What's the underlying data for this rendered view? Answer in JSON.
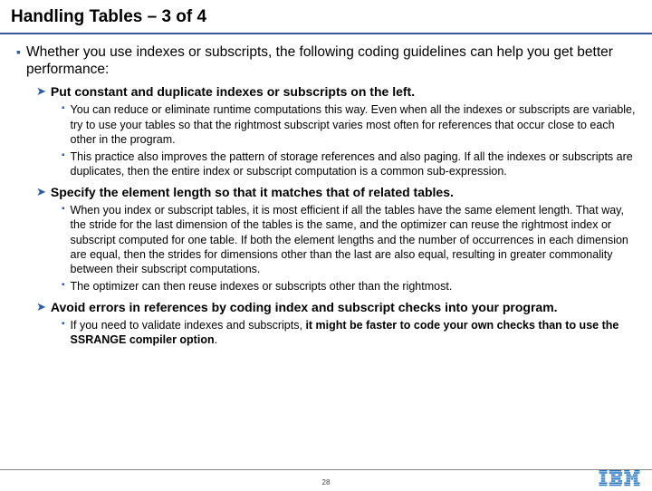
{
  "title": "Handling Tables – 3 of 4",
  "intro": "Whether you use indexes or subscripts, the following coding guidelines can help you get better performance:",
  "sections": [
    {
      "heading": "Put constant and duplicate indexes or subscripts on the left.",
      "items": [
        "You can reduce or eliminate runtime computations this way. Even when all the indexes or subscripts are variable, try to use your tables so that the rightmost subscript varies most often for references that occur close to each other in the program.",
        "This practice also improves the pattern of storage references and also paging. If all the indexes or subscripts are duplicates, then the entire index or subscript computation is a common sub-expression."
      ]
    },
    {
      "heading": "Specify the element length so that it matches that of related tables.",
      "items": [
        "When you index or subscript tables, it is most efficient if all the tables have the same element length. That way, the stride for the last dimension of the tables is the same, and the optimizer can reuse the rightmost index or subscript computed for one table. If both the element lengths and the number of occurrences in each dimension are equal, then the strides for dimensions other than the last are also equal, resulting in greater commonality between their subscript computations.",
        "The optimizer can then reuse indexes or subscripts other than the rightmost."
      ]
    },
    {
      "heading": "Avoid errors in references by coding index and subscript checks into your program.",
      "items": [
        {
          "prefix": "If you need to validate indexes and subscripts, ",
          "bold": "it might be faster to code your own checks than to use the SSRANGE compiler option",
          "suffix": "."
        }
      ]
    }
  ],
  "page_number": "28",
  "logo_text": "IBM"
}
